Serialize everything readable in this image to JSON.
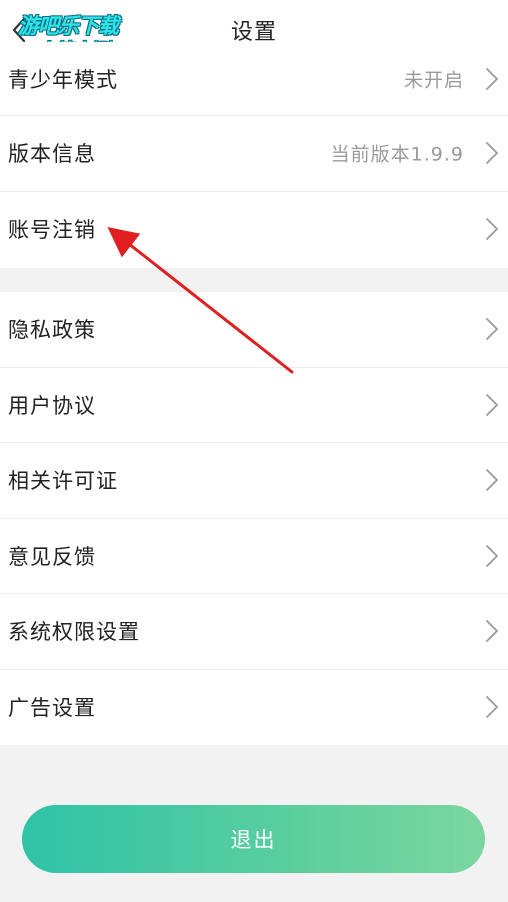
{
  "header": {
    "title": "设置",
    "back_icon": "chevron-left-icon"
  },
  "watermark": {
    "line1": "游吧乐下载",
    "line2": "小编亲测"
  },
  "settings": {
    "group1": [
      {
        "label": "青少年模式",
        "value": "未开启"
      },
      {
        "label": "版本信息",
        "value": "当前版本1.9.9"
      },
      {
        "label": "账号注销",
        "value": ""
      }
    ],
    "group2": [
      {
        "label": "隐私政策"
      },
      {
        "label": "用户协议"
      },
      {
        "label": "相关许可证"
      },
      {
        "label": "意见反馈"
      },
      {
        "label": "系统权限设置"
      },
      {
        "label": "广告设置"
      }
    ]
  },
  "logout": {
    "label": "退出"
  },
  "colors": {
    "accent_start": "#2fc3a7",
    "accent_end": "#7bd6a0",
    "annotation_arrow": "#e02020"
  }
}
